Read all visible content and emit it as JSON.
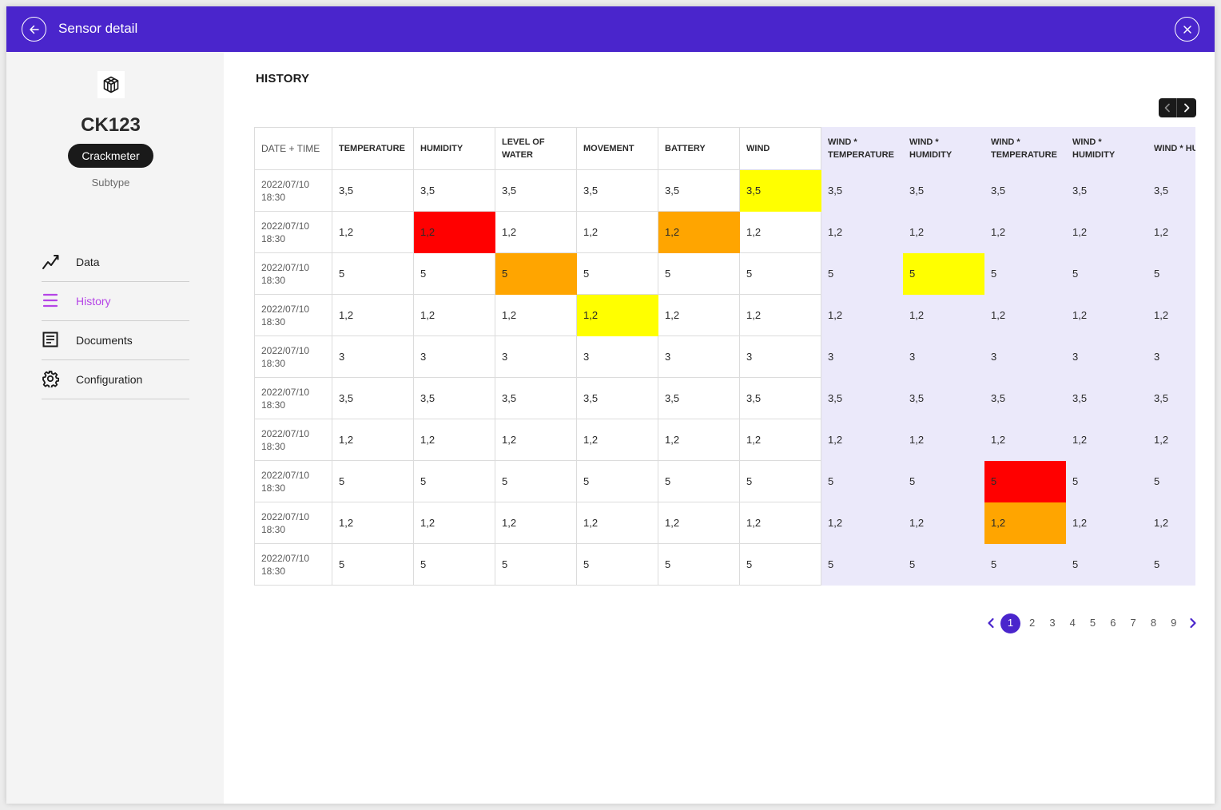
{
  "header": {
    "title": "Sensor detail"
  },
  "sensor": {
    "name": "CK123",
    "type": "Crackmeter",
    "subtype_label": "Subtype"
  },
  "nav": {
    "items": [
      {
        "label": "Data",
        "icon": "chart-line-icon"
      },
      {
        "label": "History",
        "icon": "list-icon",
        "active": true
      },
      {
        "label": "Documents",
        "icon": "document-icon"
      },
      {
        "label": "Configuration",
        "icon": "gear-icon"
      }
    ]
  },
  "history": {
    "title": "HISTORY",
    "columns": [
      "DATE + TIME",
      "TEMPERATURE",
      "HUMIDITY",
      "LEVEL OF WATER",
      "MOVEMENT",
      "BATTERY",
      "WIND",
      "WIND * TEMPERATURE",
      "WIND * HUMIDITY",
      "WIND * TEMPERATURE",
      "WIND * HUMIDITY",
      "WIND * HUMIDITY"
    ],
    "rows": [
      {
        "date": "2022/07/10",
        "time": "18:30",
        "values": [
          "3,5",
          "3,5",
          "3,5",
          "3,5",
          "3,5",
          "3,5",
          "3,5",
          "3,5",
          "3,5",
          "3,5",
          "3,5"
        ]
      },
      {
        "date": "2022/07/10",
        "time": "18:30",
        "values": [
          "1,2",
          "1,2",
          "1,2",
          "1,2",
          "1,2",
          "1,2",
          "1,2",
          "1,2",
          "1,2",
          "1,2",
          "1,2"
        ]
      },
      {
        "date": "2022/07/10",
        "time": "18:30",
        "values": [
          "5",
          "5",
          "5",
          "5",
          "5",
          "5",
          "5",
          "5",
          "5",
          "5",
          "5"
        ]
      },
      {
        "date": "2022/07/10",
        "time": "18:30",
        "values": [
          "1,2",
          "1,2",
          "1,2",
          "1,2",
          "1,2",
          "1,2",
          "1,2",
          "1,2",
          "1,2",
          "1,2",
          "1,2"
        ]
      },
      {
        "date": "2022/07/10",
        "time": "18:30",
        "values": [
          "3",
          "3",
          "3",
          "3",
          "3",
          "3",
          "3",
          "3",
          "3",
          "3",
          "3"
        ]
      },
      {
        "date": "2022/07/10",
        "time": "18:30",
        "values": [
          "3,5",
          "3,5",
          "3,5",
          "3,5",
          "3,5",
          "3,5",
          "3,5",
          "3,5",
          "3,5",
          "3,5",
          "3,5"
        ]
      },
      {
        "date": "2022/07/10",
        "time": "18:30",
        "values": [
          "1,2",
          "1,2",
          "1,2",
          "1,2",
          "1,2",
          "1,2",
          "1,2",
          "1,2",
          "1,2",
          "1,2",
          "1,2"
        ]
      },
      {
        "date": "2022/07/10",
        "time": "18:30",
        "values": [
          "5",
          "5",
          "5",
          "5",
          "5",
          "5",
          "5",
          "5",
          "5",
          "5",
          "5"
        ]
      },
      {
        "date": "2022/07/10",
        "time": "18:30",
        "values": [
          "1,2",
          "1,2",
          "1,2",
          "1,2",
          "1,2",
          "1,2",
          "1,2",
          "1,2",
          "1,2",
          "1,2",
          "1,2"
        ]
      },
      {
        "date": "2022/07/10",
        "time": "18:30",
        "values": [
          "5",
          "5",
          "5",
          "5",
          "5",
          "5",
          "5",
          "5",
          "5",
          "5",
          "5"
        ]
      }
    ],
    "highlights": [
      {
        "row": 0,
        "col": 5,
        "level": "warning"
      },
      {
        "row": 1,
        "col": 1,
        "level": "critical"
      },
      {
        "row": 1,
        "col": 4,
        "level": "alert"
      },
      {
        "row": 2,
        "col": 2,
        "level": "alert"
      },
      {
        "row": 2,
        "col": 7,
        "level": "warning"
      },
      {
        "row": 3,
        "col": 3,
        "level": "warning"
      },
      {
        "row": 7,
        "col": 8,
        "level": "critical"
      },
      {
        "row": 8,
        "col": 8,
        "level": "alert"
      }
    ],
    "combined_columns_start": 6
  },
  "pagination": {
    "pages": [
      "1",
      "2",
      "3",
      "4",
      "5",
      "6",
      "7",
      "8",
      "9"
    ],
    "current": "1"
  },
  "colors": {
    "accent": "#4a25cc",
    "nav_active": "#b545e6",
    "combined_column_bg": "#ebe9fa",
    "warning": "#ffff00",
    "alert": "#ffa500",
    "critical": "#ff0000"
  }
}
